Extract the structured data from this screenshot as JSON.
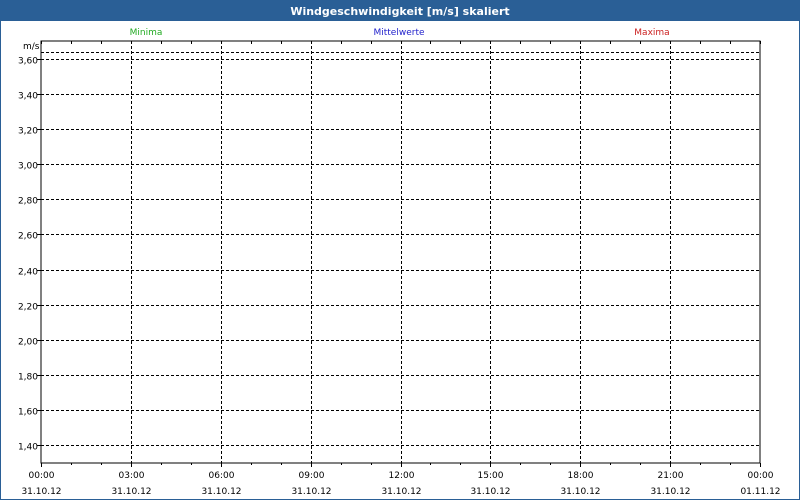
{
  "window": {
    "title": "Windgeschwindigkeit [m/s] skaliert"
  },
  "legend": [
    {
      "label": "Minima",
      "color": "#22aa22"
    },
    {
      "label": "Mittelwerte",
      "color": "#2222cc"
    },
    {
      "label": "Maxima",
      "color": "#cc2222"
    }
  ],
  "colors": {
    "titlebar": "#2a5f96",
    "grid": "#000000",
    "axis_text": "#000000"
  },
  "chart_data": {
    "type": "line",
    "title": "Windgeschwindigkeit [m/s] skaliert",
    "ylabel": "m/s",
    "xlabel": "",
    "ylim": [
      1.3,
      3.7
    ],
    "yticks": [
      1.4,
      1.6,
      1.8,
      2.0,
      2.2,
      2.4,
      2.6,
      2.8,
      3.0,
      3.2,
      3.4,
      3.6
    ],
    "ytick_labels": [
      "1,40",
      "1,60",
      "1,80",
      "2,00",
      "2,20",
      "2,40",
      "2,60",
      "2,80",
      "3,00",
      "3,20",
      "3,40",
      "3,60"
    ],
    "xlim": [
      "31.10.12 00:00",
      "01.11.12 00:00"
    ],
    "xticks_hours": [
      0,
      3,
      6,
      9,
      12,
      15,
      18,
      21,
      24
    ],
    "xtick_labels": [
      {
        "time": "00:00",
        "date": "31.10.12"
      },
      {
        "time": "03:00",
        "date": "31.10.12"
      },
      {
        "time": "06:00",
        "date": "31.10.12"
      },
      {
        "time": "09:00",
        "date": "31.10.12"
      },
      {
        "time": "12:00",
        "date": "31.10.12"
      },
      {
        "time": "15:00",
        "date": "31.10.12"
      },
      {
        "time": "18:00",
        "date": "31.10.12"
      },
      {
        "time": "21:00",
        "date": "31.10.12"
      },
      {
        "time": "00:00",
        "date": "01.11.12"
      }
    ],
    "grid": true,
    "series": [
      {
        "name": "Minima",
        "color": "#22aa22",
        "x": [],
        "values": []
      },
      {
        "name": "Mittelwerte",
        "color": "#2222cc",
        "x": [],
        "values": []
      },
      {
        "name": "Maxima",
        "color": "#cc2222",
        "x": [],
        "values": []
      }
    ]
  }
}
